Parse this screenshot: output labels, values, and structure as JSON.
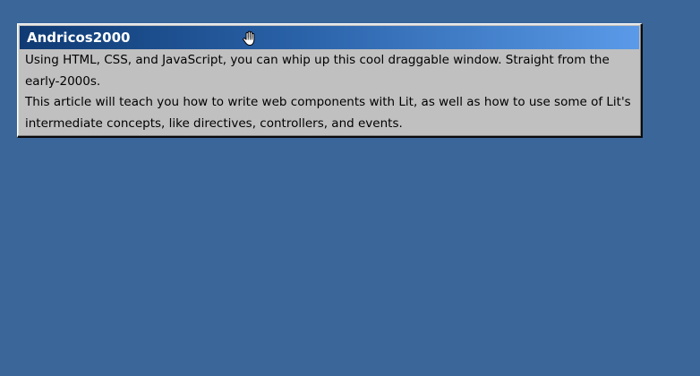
{
  "window": {
    "title": "Andricos2000",
    "paragraphs": [
      "Using HTML, CSS, and JavaScript, you can whip up this cool draggable window. Straight from the early-2000s.",
      "This article will teach you how to write web components with Lit, as well as how to use some of Lit's intermediate concepts, like directives, controllers, and events."
    ]
  },
  "icons": {
    "cursor": "grab-hand-cursor-icon"
  },
  "colors": {
    "desktop_background": "#3a6699",
    "window_face": "#c0c0c0",
    "titlebar_start": "#0f3a73",
    "titlebar_end": "#5a9ae8",
    "title_text": "#ffffff"
  }
}
